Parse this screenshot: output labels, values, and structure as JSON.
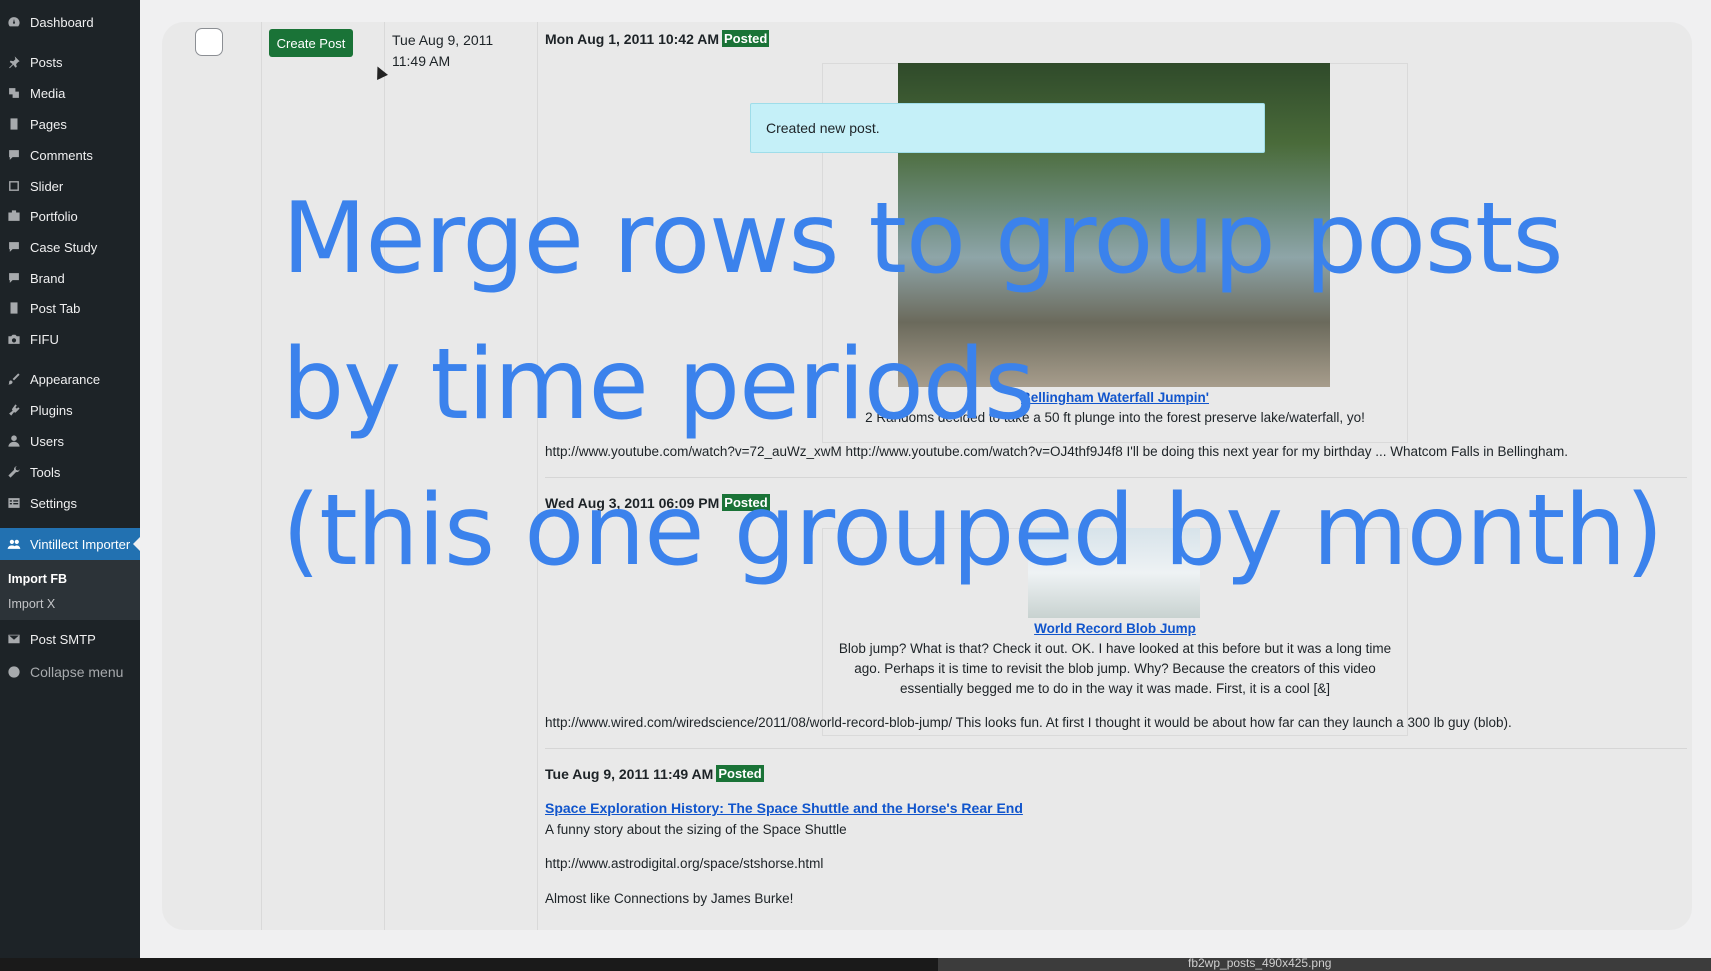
{
  "sidebar": {
    "items": [
      {
        "label": "Dashboard",
        "icon": "dashboard-icon"
      },
      {
        "label": "Posts",
        "icon": "pin-icon"
      },
      {
        "label": "Media",
        "icon": "media-icon"
      },
      {
        "label": "Pages",
        "icon": "page-icon"
      },
      {
        "label": "Comments",
        "icon": "comment-icon"
      },
      {
        "label": "Slider",
        "icon": "slider-icon"
      },
      {
        "label": "Portfolio",
        "icon": "portfolio-icon"
      },
      {
        "label": "Case Study",
        "icon": "comment-icon"
      },
      {
        "label": "Brand",
        "icon": "comment-icon"
      },
      {
        "label": "Post Tab",
        "icon": "page-icon"
      },
      {
        "label": "FIFU",
        "icon": "camera-icon"
      },
      {
        "label": "Appearance",
        "icon": "brush-icon"
      },
      {
        "label": "Plugins",
        "icon": "plugin-icon"
      },
      {
        "label": "Users",
        "icon": "user-icon"
      },
      {
        "label": "Tools",
        "icon": "wrench-icon"
      },
      {
        "label": "Settings",
        "icon": "settings-icon"
      },
      {
        "label": "Vintillect Importer",
        "icon": "users-icon"
      }
    ],
    "submenu": [
      "Import FB",
      "Import X"
    ],
    "post_smtp": "Post SMTP",
    "collapse": "Collapse menu"
  },
  "row": {
    "create_button": "Create Post",
    "date_line1": "Tue Aug 9, 2011",
    "date_line2": "11:49 AM"
  },
  "toast": "Created new post.",
  "posts": [
    {
      "date": "Mon Aug 1, 2011 10:42 AM",
      "status": "Posted",
      "link_title": "Bellingham Waterfall Jumpin'",
      "desc": "2 Randoms decided to take a 50 ft plunge into the forest preserve lake/waterfall, yo!",
      "body": "http://www.youtube.com/watch?v=72_auWz_xwM http://www.youtube.com/watch?v=OJ4thf9J4f8 I'll be doing this next year for my birthday ... Whatcom Falls in Bellingham."
    },
    {
      "date": "Wed Aug 3, 2011 06:09 PM",
      "status": "Posted",
      "link_title": "World Record Blob Jump",
      "desc1": "Blob jump? What is that? Check it out. OK. I have looked at this before   but it was a long time",
      "desc2": "ago. Perhaps it is time to revisit the blob jump. Why? Because the creators of this video",
      "desc3": "essentially begged me to do in the way it was made. First, it is a cool [&]",
      "body": "http://www.wired.com/wiredscience/2011/08/world-record-blob-jump/ This looks fun. At first I thought it would be about how far can they launch a 300 lb guy (blob)."
    },
    {
      "date": "Tue Aug 9, 2011 11:49 AM",
      "status": "Posted",
      "link_title": "Space Exploration History: The Space Shuttle and the Horse's Rear End",
      "line1": "A funny story about the sizing of the Space Shuttle",
      "line2": "http://www.astrodigital.org/space/stshorse.html",
      "line3": "Almost like Connections by James Burke!"
    }
  ],
  "overlay": {
    "line1": "Merge rows to group posts",
    "line2": "by time periods",
    "line3": "(this one grouped by month)"
  },
  "taskbar_file": "fb2wp_posts_490x425.png"
}
